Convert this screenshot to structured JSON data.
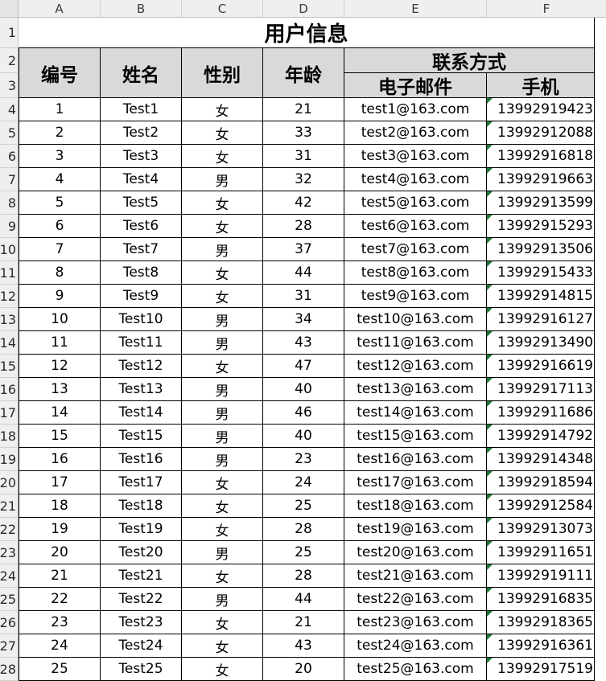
{
  "columns": [
    "A",
    "B",
    "C",
    "D",
    "E",
    "F"
  ],
  "row_numbers": [
    "1",
    "2",
    "3",
    "4",
    "5",
    "6",
    "7",
    "8",
    "9",
    "10",
    "11",
    "12",
    "13",
    "14",
    "15",
    "16",
    "17",
    "18",
    "19",
    "20",
    "21",
    "22",
    "23",
    "24",
    "25",
    "26",
    "27",
    "28"
  ],
  "title": "用户信息",
  "headers": {
    "id": "编号",
    "name": "姓名",
    "gender": "性别",
    "age": "年龄",
    "contact": "联系方式",
    "email": "电子邮件",
    "phone": "手机"
  },
  "rows": [
    [
      "1",
      "Test1",
      "女",
      "21",
      "test1@163.com",
      "13992919423"
    ],
    [
      "2",
      "Test2",
      "女",
      "33",
      "test2@163.com",
      "13992912088"
    ],
    [
      "3",
      "Test3",
      "女",
      "31",
      "test3@163.com",
      "13992916818"
    ],
    [
      "4",
      "Test4",
      "男",
      "32",
      "test4@163.com",
      "13992919663"
    ],
    [
      "5",
      "Test5",
      "女",
      "42",
      "test5@163.com",
      "13992913599"
    ],
    [
      "6",
      "Test6",
      "女",
      "28",
      "test6@163.com",
      "13992915293"
    ],
    [
      "7",
      "Test7",
      "男",
      "37",
      "test7@163.com",
      "13992913506"
    ],
    [
      "8",
      "Test8",
      "女",
      "44",
      "test8@163.com",
      "13992915433"
    ],
    [
      "9",
      "Test9",
      "女",
      "31",
      "test9@163.com",
      "13992914815"
    ],
    [
      "10",
      "Test10",
      "男",
      "34",
      "test10@163.com",
      "13992916127"
    ],
    [
      "11",
      "Test11",
      "男",
      "43",
      "test11@163.com",
      "13992913490"
    ],
    [
      "12",
      "Test12",
      "女",
      "47",
      "test12@163.com",
      "13992916619"
    ],
    [
      "13",
      "Test13",
      "男",
      "40",
      "test13@163.com",
      "13992917113"
    ],
    [
      "14",
      "Test14",
      "男",
      "46",
      "test14@163.com",
      "13992911686"
    ],
    [
      "15",
      "Test15",
      "男",
      "40",
      "test15@163.com",
      "13992914792"
    ],
    [
      "16",
      "Test16",
      "男",
      "23",
      "test16@163.com",
      "13992914348"
    ],
    [
      "17",
      "Test17",
      "女",
      "24",
      "test17@163.com",
      "13992918594"
    ],
    [
      "18",
      "Test18",
      "女",
      "25",
      "test18@163.com",
      "13992912584"
    ],
    [
      "19",
      "Test19",
      "女",
      "28",
      "test19@163.com",
      "13992913073"
    ],
    [
      "20",
      "Test20",
      "男",
      "25",
      "test20@163.com",
      "13992911651"
    ],
    [
      "21",
      "Test21",
      "女",
      "28",
      "test21@163.com",
      "13992919111"
    ],
    [
      "22",
      "Test22",
      "男",
      "44",
      "test22@163.com",
      "13992916835"
    ],
    [
      "23",
      "Test23",
      "女",
      "21",
      "test23@163.com",
      "13992918365"
    ],
    [
      "24",
      "Test24",
      "女",
      "43",
      "test24@163.com",
      "13992916361"
    ],
    [
      "25",
      "Test25",
      "女",
      "20",
      "test25@163.com",
      "13992917519"
    ]
  ],
  "colors": {
    "header_fill": "#d9d9d9",
    "error_indicator": "#1e7b34",
    "grid_header_fill": "#efefef"
  }
}
